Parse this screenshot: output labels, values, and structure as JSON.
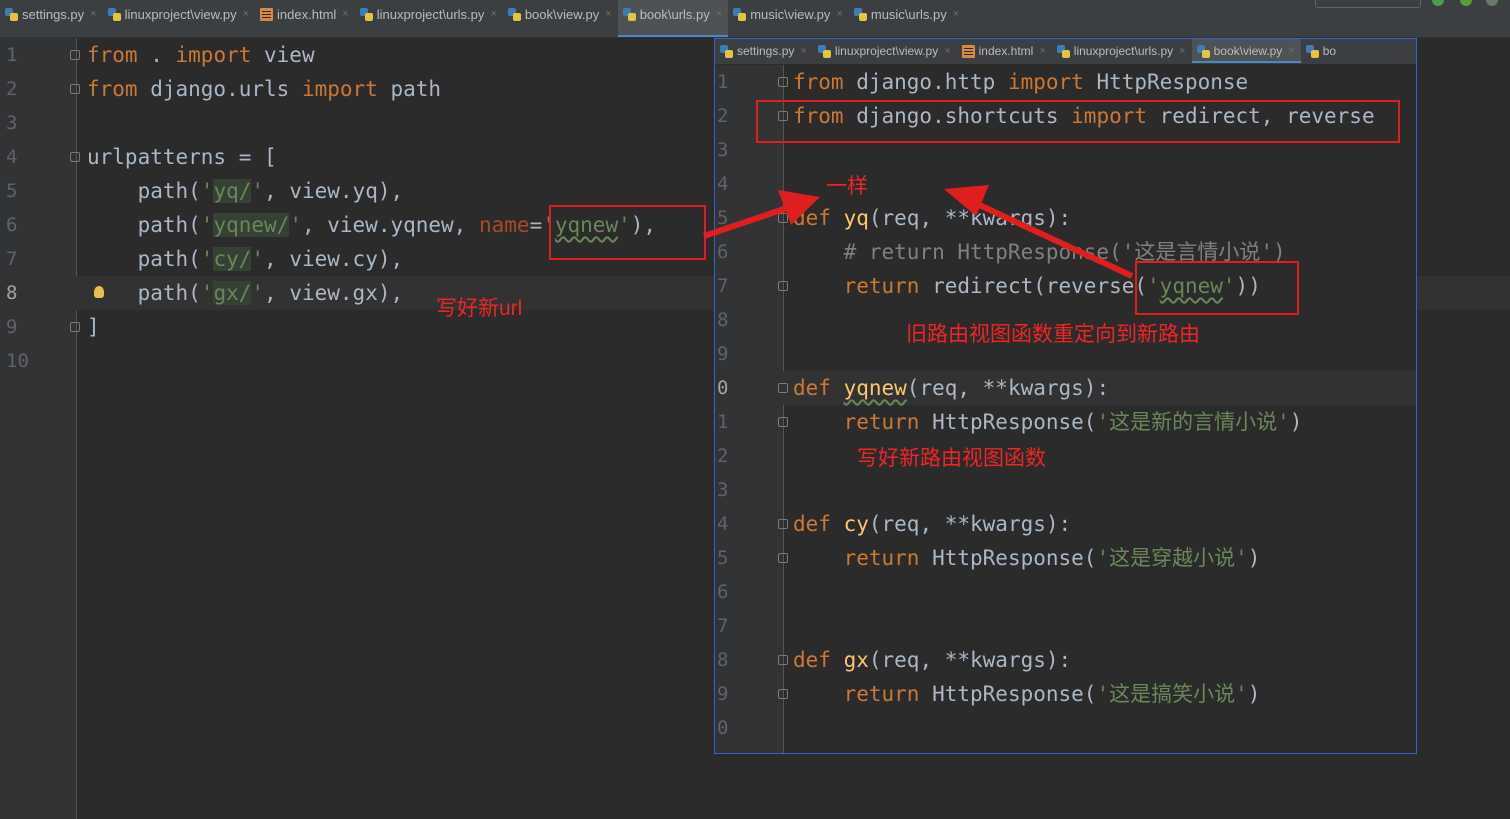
{
  "main_tabs": [
    {
      "label": "settings.py",
      "type": "py",
      "active": false
    },
    {
      "label": "linuxproject\\view.py",
      "type": "py",
      "active": false
    },
    {
      "label": "index.html",
      "type": "html",
      "active": false
    },
    {
      "label": "linuxproject\\urls.py",
      "type": "py",
      "active": false
    },
    {
      "label": "book\\view.py",
      "type": "py",
      "active": false
    },
    {
      "label": "book\\urls.py",
      "type": "py",
      "active": true
    },
    {
      "label": "music\\view.py",
      "type": "py",
      "active": false
    },
    {
      "label": "music\\urls.py",
      "type": "py",
      "active": false
    }
  ],
  "inner_tabs": [
    {
      "label": "settings.py",
      "type": "py",
      "active": false
    },
    {
      "label": "linuxproject\\view.py",
      "type": "py",
      "active": false
    },
    {
      "label": "index.html",
      "type": "html",
      "active": false
    },
    {
      "label": "linuxproject\\urls.py",
      "type": "py",
      "active": false
    },
    {
      "label": "book\\view.py",
      "type": "py",
      "active": true
    },
    {
      "label": "bo",
      "type": "py",
      "active": false
    }
  ],
  "close_glyph": "×",
  "main_editor": {
    "line_numbers": [
      "1",
      "2",
      "3",
      "4",
      "5",
      "6",
      "7",
      "8",
      "9",
      "10"
    ],
    "current_line": "8",
    "lines": [
      [
        {
          "t": "from",
          "c": "kw"
        },
        {
          "t": " . "
        },
        {
          "t": "import",
          "c": "kw"
        },
        {
          "t": " view"
        }
      ],
      [
        {
          "t": "from",
          "c": "kw"
        },
        {
          "t": " django.urls "
        },
        {
          "t": "import",
          "c": "kw"
        },
        {
          "t": " path"
        }
      ],
      [],
      [
        {
          "t": "urlpatterns = ["
        }
      ],
      [
        {
          "t": "    path("
        },
        {
          "t": "'",
          "c": "str"
        },
        {
          "t": "yq/",
          "c": "str bhl"
        },
        {
          "t": "'",
          "c": "str"
        },
        {
          "t": ", view.yq),"
        }
      ],
      [
        {
          "t": "    path("
        },
        {
          "t": "'",
          "c": "str"
        },
        {
          "t": "yqnew/",
          "c": "str bhl"
        },
        {
          "t": "'",
          "c": "str"
        },
        {
          "t": ", view.yqnew, "
        },
        {
          "t": "name",
          "c": "par"
        },
        {
          "t": "="
        },
        {
          "t": "'",
          "c": "str"
        },
        {
          "t": "yqnew",
          "c": "str wavy"
        },
        {
          "t": "'",
          "c": "str"
        },
        {
          "t": "),"
        }
      ],
      [
        {
          "t": "    path("
        },
        {
          "t": "'",
          "c": "str"
        },
        {
          "t": "cy/",
          "c": "str bhl"
        },
        {
          "t": "'",
          "c": "str"
        },
        {
          "t": ", view.cy),"
        }
      ],
      [
        {
          "t": "    path("
        },
        {
          "t": "'",
          "c": "str"
        },
        {
          "t": "gx/",
          "c": "str bhl"
        },
        {
          "t": "'",
          "c": "str"
        },
        {
          "t": ", view.gx),"
        }
      ],
      [
        {
          "t": "]"
        }
      ],
      []
    ]
  },
  "inner_editor": {
    "line_numbers": [
      "1",
      "2",
      "3",
      "4",
      "5",
      "6",
      "7",
      "8",
      "9",
      "0",
      "1",
      "2",
      "3",
      "4",
      "5",
      "6",
      "7",
      "8",
      "9",
      "0"
    ],
    "current_index": 9,
    "lines": [
      [
        {
          "t": "from",
          "c": "kw"
        },
        {
          "t": " django.http "
        },
        {
          "t": "import",
          "c": "kw"
        },
        {
          "t": " HttpResponse"
        }
      ],
      [
        {
          "t": "from",
          "c": "kw"
        },
        {
          "t": " django.shortcuts "
        },
        {
          "t": "import",
          "c": "kw"
        },
        {
          "t": " redirect, reverse"
        }
      ],
      [],
      [],
      [
        {
          "t": "def ",
          "c": "kw"
        },
        {
          "t": "yq",
          "c": "fn"
        },
        {
          "t": "(req, **kwargs):"
        }
      ],
      [
        {
          "t": "    # return HttpResponse('这是言情小说')",
          "c": "cmt"
        }
      ],
      [
        {
          "t": "    "
        },
        {
          "t": "return",
          "c": "kw"
        },
        {
          "t": " redirect(reverse("
        },
        {
          "t": "'",
          "c": "str"
        },
        {
          "t": "yqnew",
          "c": "str wavy"
        },
        {
          "t": "'",
          "c": "str"
        },
        {
          "t": "))"
        }
      ],
      [],
      [],
      [
        {
          "t": "def ",
          "c": "kw"
        },
        {
          "t": "yqnew",
          "c": "fn wavy"
        },
        {
          "t": "(req, **kwargs):"
        }
      ],
      [
        {
          "t": "    "
        },
        {
          "t": "return",
          "c": "kw"
        },
        {
          "t": " HttpResponse("
        },
        {
          "t": "'这是新的言情小说'",
          "c": "str"
        },
        {
          "t": ")"
        }
      ],
      [],
      [],
      [
        {
          "t": "def ",
          "c": "kw"
        },
        {
          "t": "cy",
          "c": "fn"
        },
        {
          "t": "(req, **kwargs):"
        }
      ],
      [
        {
          "t": "    "
        },
        {
          "t": "return",
          "c": "kw"
        },
        {
          "t": " HttpResponse("
        },
        {
          "t": "'这是穿越小说'",
          "c": "str"
        },
        {
          "t": ")"
        }
      ],
      [],
      [],
      [
        {
          "t": "def ",
          "c": "kw"
        },
        {
          "t": "gx",
          "c": "fn"
        },
        {
          "t": "(req, **kwargs):"
        }
      ],
      [
        {
          "t": "    "
        },
        {
          "t": "return",
          "c": "kw"
        },
        {
          "t": " HttpResponse("
        },
        {
          "t": "'这是搞笑小说'",
          "c": "str"
        },
        {
          "t": ")"
        }
      ],
      []
    ]
  },
  "annotations": {
    "write_url": "写好新url",
    "same": "一样",
    "redirect_note": "旧路由视图函数重定向到新路由",
    "new_view_note": "写好新路由视图函数"
  },
  "colors": {
    "background": "#2b2b2b",
    "keyword": "#cc7832",
    "string": "#6a8759",
    "function": "#ffc66d",
    "annotation": "#f02424",
    "accent": "#4a88c7"
  }
}
